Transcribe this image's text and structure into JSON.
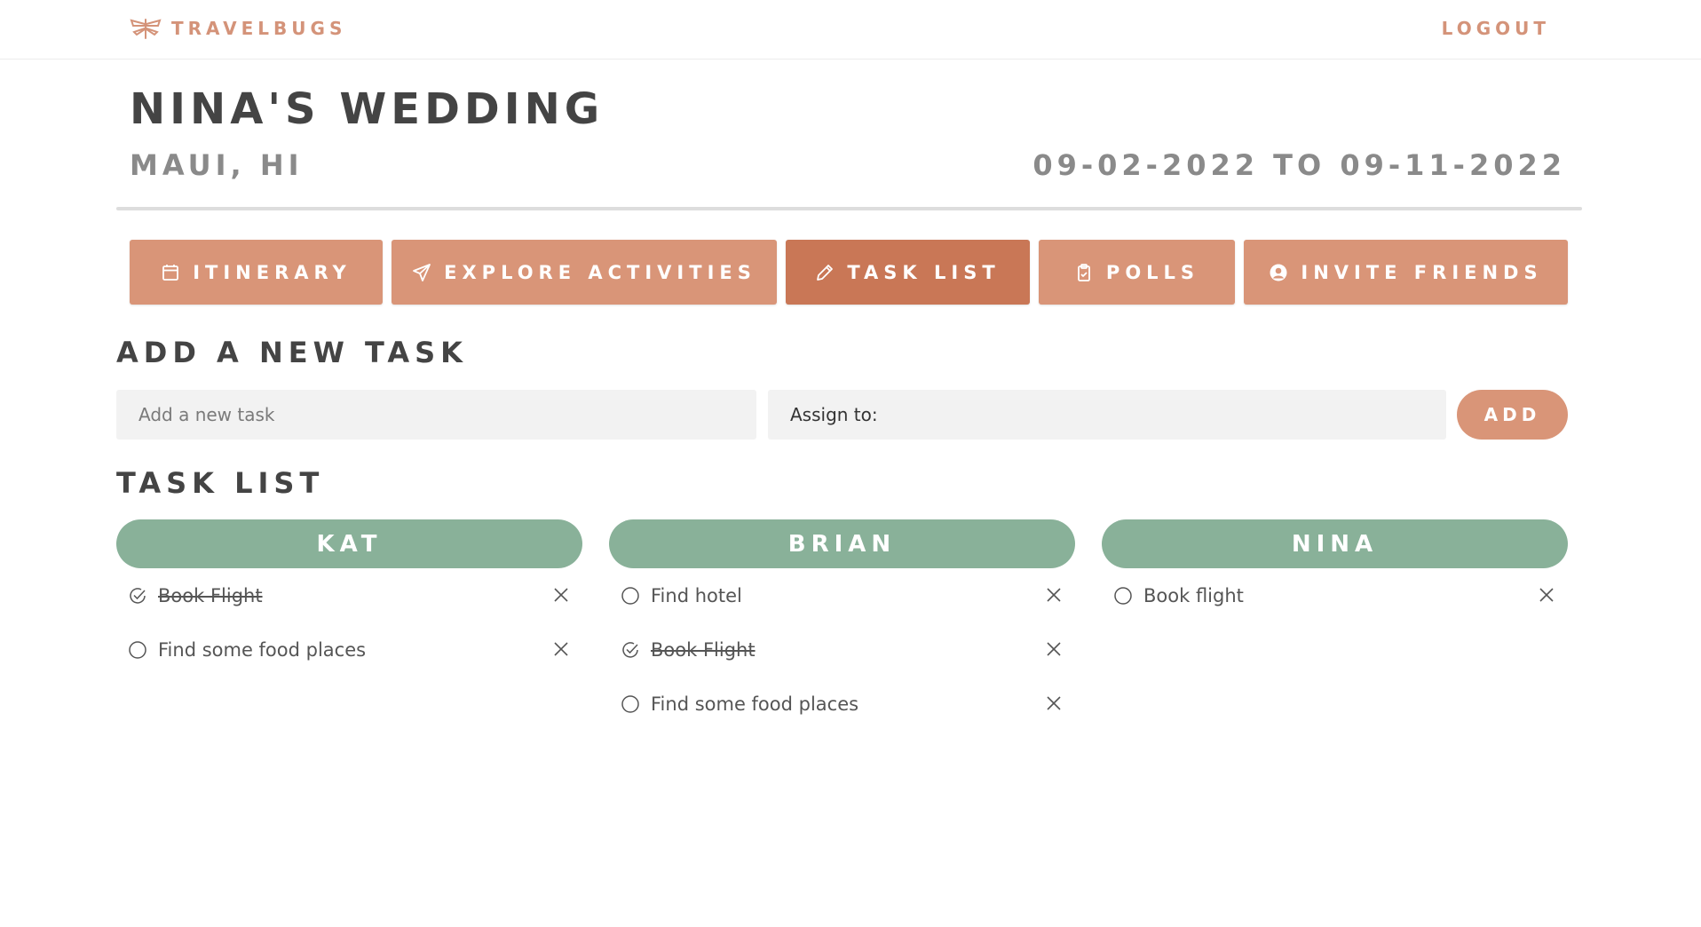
{
  "nav": {
    "brand": "TRAVELBUGS",
    "brand_icon": "dragonfly-icon",
    "logout_label": "LOGOUT",
    "accent_color": "#d49379"
  },
  "trip": {
    "title": "NINA'S WEDDING",
    "location": "MAUI, HI",
    "dates": "09-02-2022 TO 09-11-2022"
  },
  "tabs": [
    {
      "label": "ITINERARY",
      "icon": "calendar-icon",
      "active": false
    },
    {
      "label": "EXPLORE ACTIVITIES",
      "icon": "paper-plane-icon",
      "active": false
    },
    {
      "label": "TASK LIST",
      "icon": "pencil-icon",
      "active": true
    },
    {
      "label": "POLLS",
      "icon": "clipboard-check-icon",
      "active": false
    },
    {
      "label": "INVITE FRIENDS",
      "icon": "user-circle-icon",
      "active": false
    }
  ],
  "add_task": {
    "heading": "ADD A NEW TASK",
    "task_placeholder": "Add a new task",
    "assign_label": "Assign to:",
    "add_label": "ADD"
  },
  "task_list": {
    "heading": "TASK LIST",
    "header_color": "#89b199",
    "columns": [
      {
        "name": "KAT",
        "tasks": [
          {
            "text": "Book Flight",
            "done": true
          },
          {
            "text": "Find some food places",
            "done": false
          }
        ]
      },
      {
        "name": "BRIAN",
        "tasks": [
          {
            "text": "Find hotel",
            "done": false
          },
          {
            "text": "Book Flight",
            "done": true
          },
          {
            "text": "Find some food places",
            "done": false
          }
        ]
      },
      {
        "name": "NINA",
        "tasks": [
          {
            "text": "Book flight",
            "done": false
          }
        ]
      }
    ]
  }
}
